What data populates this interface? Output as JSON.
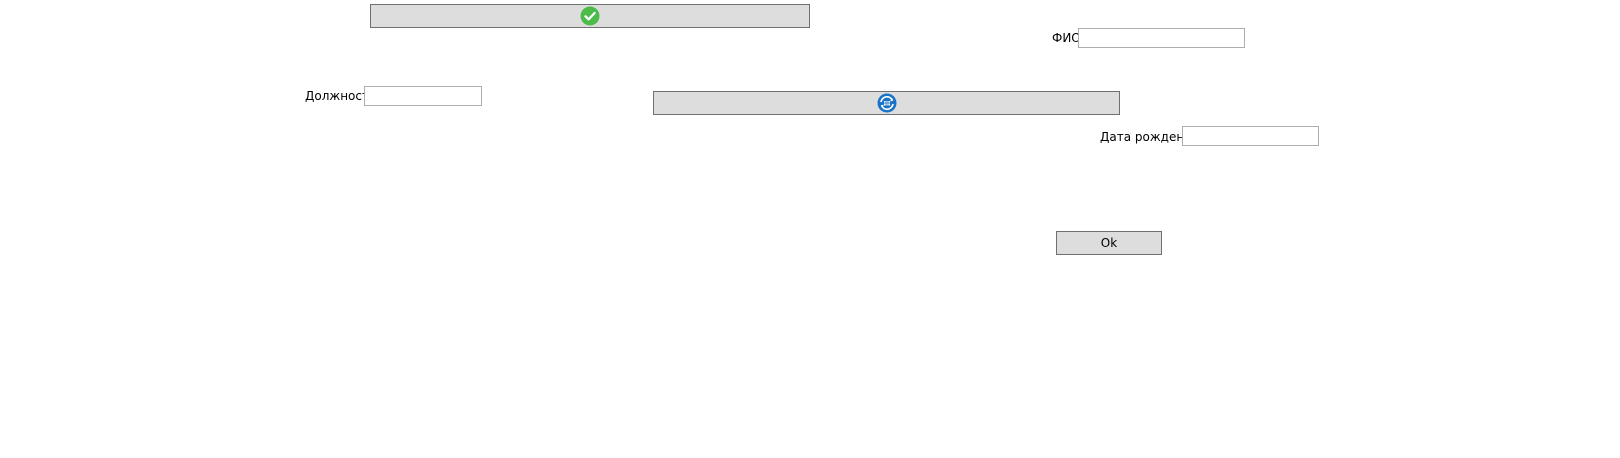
{
  "buttons": {
    "confirm_icon": "check-circle-icon",
    "refresh_icon": "database-refresh-icon",
    "ok_label": "Ok"
  },
  "fields": {
    "fio": {
      "label": "ФИО",
      "value": ""
    },
    "position": {
      "label": "Должность",
      "value": ""
    },
    "birth_date": {
      "label": "Дата рождения",
      "value": ""
    }
  },
  "colors": {
    "button_bg": "#dddddd",
    "button_border": "#707070",
    "check_green": "#4cbb4a",
    "refresh_blue": "#1a73c8"
  }
}
